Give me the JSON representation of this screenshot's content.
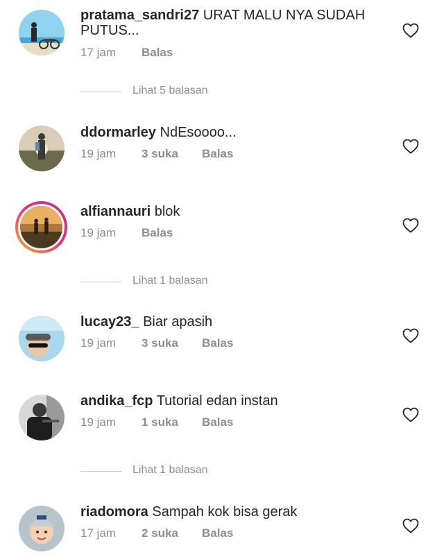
{
  "comments": [
    {
      "username": "pratama_sandri27",
      "text": "URAT MALU NYA SUDAH PUTUS...",
      "time": "17 jam",
      "likes": "",
      "reply": "Balas",
      "avatar": "avatar-photo-beach-bike",
      "story_ring": false
    },
    {
      "username": "ddormarley",
      "text": "NdEsoooo...",
      "time": "19 jam",
      "likes": "3 suka",
      "reply": "Balas",
      "avatar": "avatar-photo-sunset-person",
      "story_ring": false
    },
    {
      "username": "alfiannauri",
      "text": "blok",
      "time": "19 jam",
      "likes": "",
      "reply": "Balas",
      "avatar": "avatar-photo-field-sunset",
      "story_ring": true
    },
    {
      "username": "lucay23_",
      "text": "Biar apasih",
      "time": "19 jam",
      "likes": "3 suka",
      "reply": "Balas",
      "avatar": "avatar-photo-selfie-glasses",
      "story_ring": false
    },
    {
      "username": "andika_fcp",
      "text": "Tutorial edan instan",
      "time": "19 jam",
      "likes": "1 suka",
      "reply": "Balas",
      "avatar": "avatar-photo-mono-person",
      "story_ring": false
    },
    {
      "username": "riadomora",
      "text": "Sampah kok bisa gerak",
      "time": "17 jam",
      "likes": "2 suka",
      "reply": "Balas",
      "avatar": "avatar-photo-child-cap",
      "story_ring": false
    }
  ],
  "view_replies": [
    "Lihat 5 balasan",
    "Lihat 1 balasan",
    "Lihat 1 balasan"
  ],
  "icons": {
    "like": "heart-outline-icon"
  },
  "colors": {
    "text": "#262626",
    "secondary": "#8e8e8e",
    "divider": "#c7c7c7",
    "ring_start": "#f9a825",
    "ring_end": "#c13584"
  }
}
